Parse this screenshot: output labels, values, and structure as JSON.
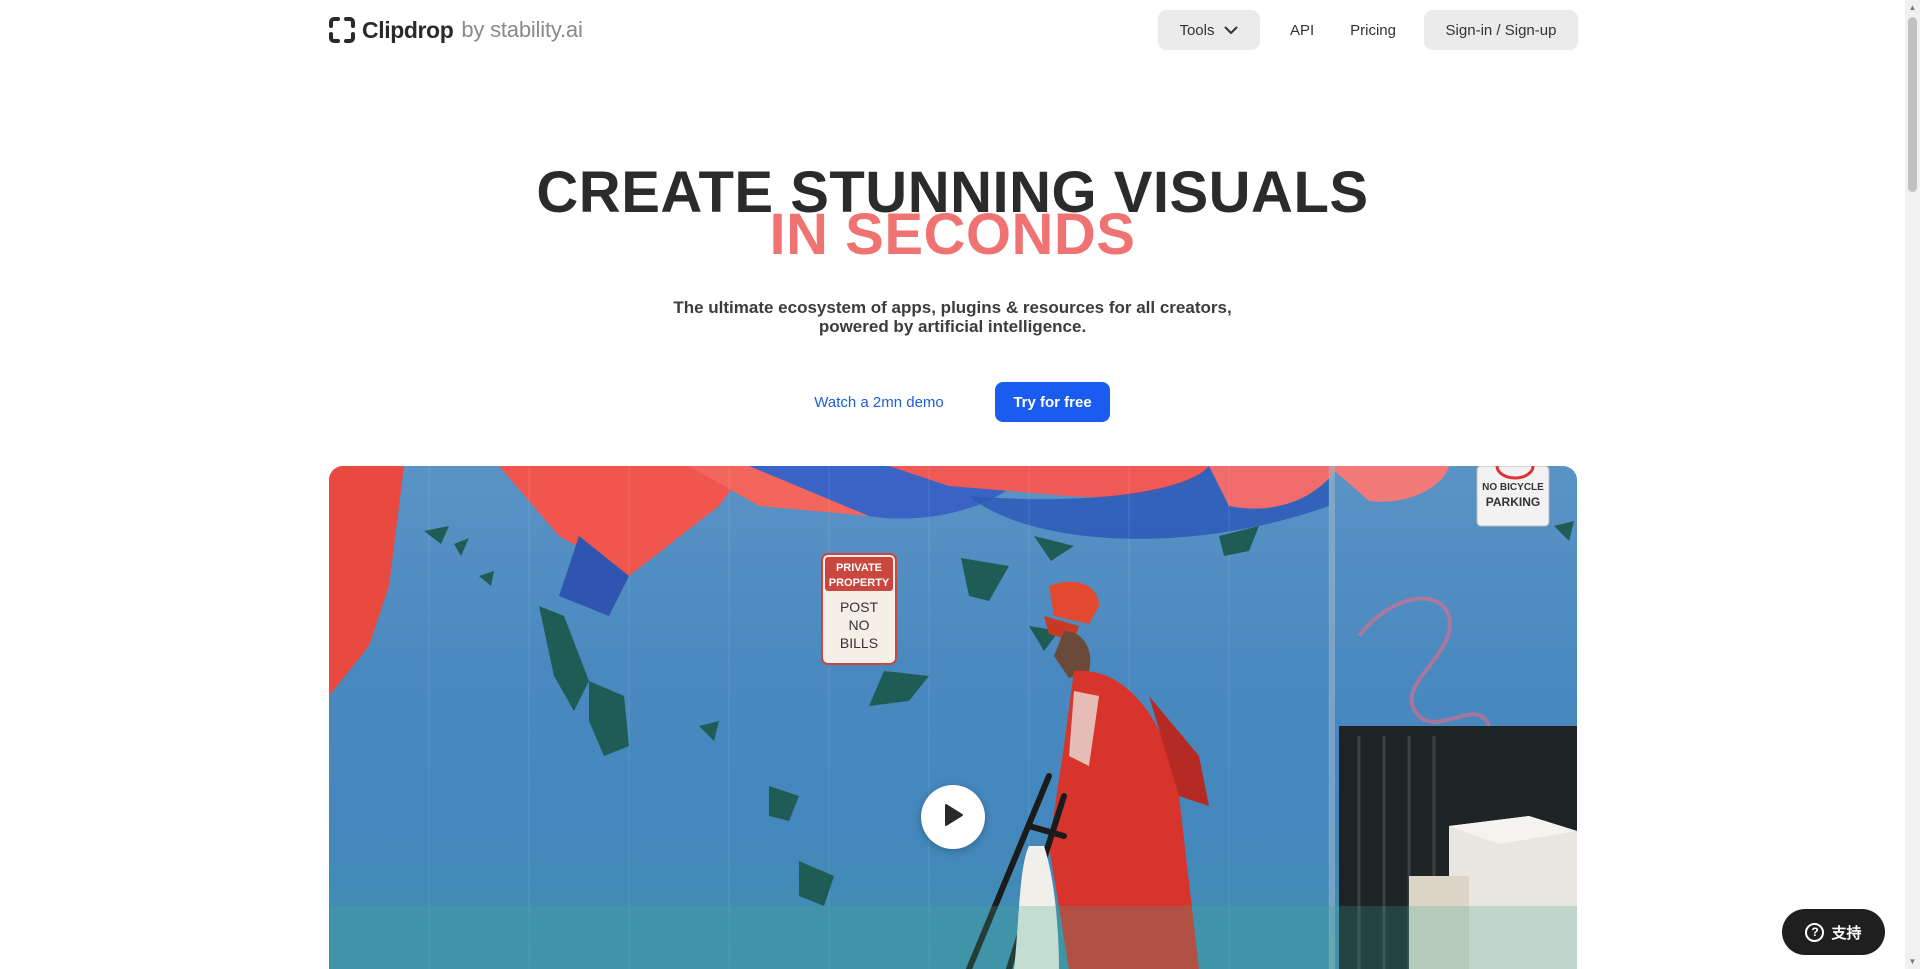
{
  "header": {
    "logo_name": "Clipdrop",
    "logo_by": "by stability.ai",
    "nav": {
      "tools_label": "Tools",
      "api_label": "API",
      "pricing_label": "Pricing",
      "signin_label": "Sign-in / Sign-up"
    }
  },
  "hero": {
    "title_line1": "CREATE STUNNING VISUALS",
    "title_line2": "IN SECONDS",
    "subtitle_line1": "The ultimate ecosystem of apps, plugins & resources for all creators,",
    "subtitle_line2": "powered by artificial intelligence.",
    "demo_label": "Watch a 2mn demo",
    "try_label": "Try for free"
  },
  "media": {
    "sign_private": [
      "PRIVATE",
      "PROPERTY",
      "POST",
      "NO",
      "BILLS"
    ],
    "sign_parking": [
      "NO BICYCLE",
      "PARKING"
    ]
  },
  "support": {
    "label": "支持"
  },
  "colors": {
    "accent_blue": "#1a5cf0",
    "title_pink": "#f07373",
    "nav_bg": "#ebebeb",
    "support_bg": "#1f1f1f"
  },
  "icons": {
    "logo": "clipdrop-logo-icon",
    "tools_chevron": "chevron-down-icon",
    "play": "play-icon",
    "support": "question-icon"
  }
}
